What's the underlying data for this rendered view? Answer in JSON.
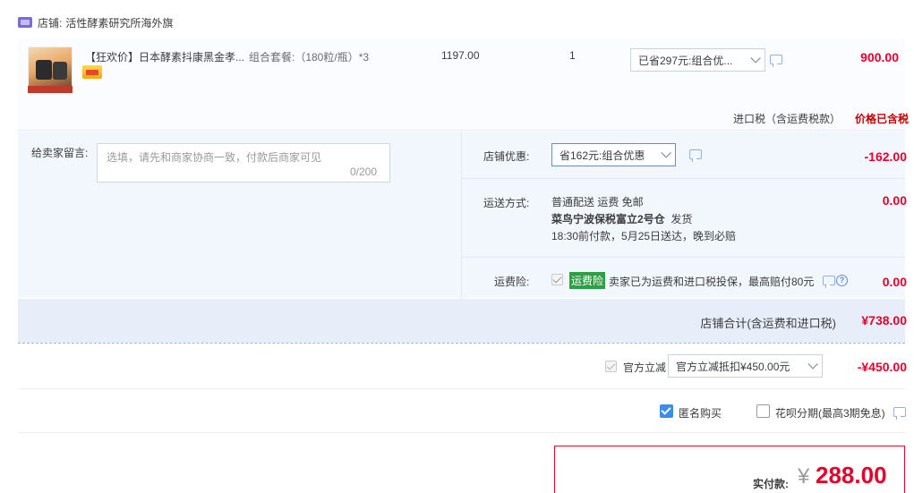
{
  "shop": {
    "label": "店铺:",
    "name": "活性酵素研究所海外旗"
  },
  "item": {
    "title": "【狂欢价】日本酵素抖康黑金孝...",
    "sku": "组合套餐:（180粒/瓶）*3",
    "unit_price": "1197.00",
    "quantity": "1",
    "discount_select": "已省297元:组合优...",
    "subtotal": "900.00"
  },
  "tax": {
    "label": "进口税（含运费税款）",
    "state": "价格已含税"
  },
  "message": {
    "label": "给卖家留言:",
    "placeholder": "选填，请先和商家协商一致，付款后商家可见",
    "count": "0/200"
  },
  "shop_coupon": {
    "label": "店铺优惠:",
    "select": "省162元:组合优惠",
    "amount": "-162.00"
  },
  "shipping": {
    "label": "运送方式:",
    "line1": "普通配送 运费 免邮",
    "line2_bold": "菜鸟宁波保税富立2号仓",
    "line2_tail": "发货",
    "line3": "18:30前付款，5月25日送达，晚到必赔",
    "amount": "0.00"
  },
  "insurance": {
    "label": "运费险:",
    "tag": "运费险",
    "text": "卖家已为运费和进口税投保，最高赔付80元",
    "amount": "0.00"
  },
  "shop_total": {
    "label": "店铺合计(含运费和进口税)",
    "amount": "¥738.00"
  },
  "platform": {
    "label": "官方立减",
    "select": "官方立减抵扣¥450.00元",
    "amount": "-¥450.00"
  },
  "options": {
    "anonymous": "匿名购买",
    "huabei": "花呗分期(最高3期免息)"
  },
  "pay": {
    "label": "实付款:",
    "currency": "¥",
    "amount": "288.00"
  },
  "colors": {
    "accent_red": "#e4002b",
    "accent_blue": "#3c8cf0",
    "panel_bg": "#f2f6fd",
    "total_bg": "#e7eefa"
  },
  "icons": [
    "shop-icon",
    "chat-icon",
    "chevron-down-icon",
    "help-icon",
    "checkbox-icon"
  ]
}
